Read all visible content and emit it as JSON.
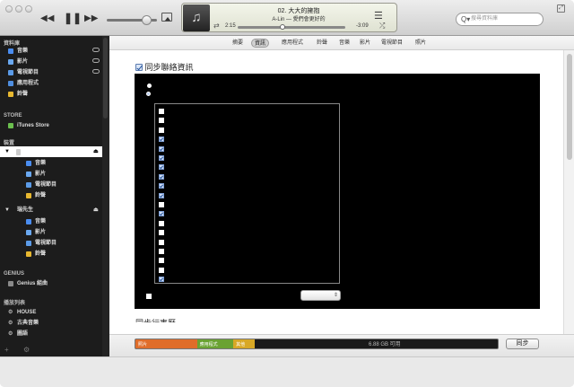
{
  "window": {
    "fullscreen_glyph": "⤢"
  },
  "player": {
    "prev_glyph": "◀◀",
    "pause_glyph": "❚❚",
    "next_glyph": "▶▶",
    "art_glyph": "♫",
    "song_title": "02. 大大的擁抱",
    "artist_album": "A-Lin — 愛們會更好的",
    "elapsed": "2:15",
    "remaining": "-3:09",
    "progress_fraction": 0.42,
    "volume_fraction": 0.78,
    "repeat_glyph": "⇄",
    "shuffle_glyph": "⤮",
    "list_glyph": "☰"
  },
  "search": {
    "placeholder": "搜尋資料庫",
    "icon": "search-icon",
    "icon_glyph": "Q▾"
  },
  "sidebar": {
    "library_header": "資料庫",
    "library_items": [
      {
        "label": "音樂",
        "icon": "music-icon",
        "color": "#4a8df0"
      },
      {
        "label": "影片",
        "icon": "movie-icon",
        "color": "#6aa8f0"
      },
      {
        "label": "電視節目",
        "icon": "tv-icon",
        "color": "#5b9be8"
      },
      {
        "label": "應用程式",
        "icon": "apps-icon",
        "color": "#4f8ee0"
      },
      {
        "label": "鈴聲",
        "icon": "bell-icon",
        "color": "#e8b830"
      }
    ],
    "store_header": "STORE",
    "store_item": "iTunes Store",
    "devices_header": "裝置",
    "device1_name": "",
    "device1_items": [
      "音樂",
      "影片",
      "電視節目",
      "鈴聲"
    ],
    "device2_name": "瑞先生",
    "device2_items": [
      "音樂",
      "影片",
      "電視節目",
      "鈴聲"
    ],
    "genius_header": "GENIUS",
    "genius_item": "Genius 組曲",
    "playlists_header": "播放列表",
    "playlist_items": [
      "HOUSE",
      "古典音樂",
      "圖語"
    ],
    "add_glyph": "+",
    "gear_glyph": "⚙"
  },
  "tabs": [
    {
      "label": "摘要",
      "active": false
    },
    {
      "label": "資訊",
      "active": true
    },
    {
      "label": "應用程式",
      "active": false
    },
    {
      "label": "鈴聲",
      "active": false
    },
    {
      "label": "音樂",
      "active": false
    },
    {
      "label": "影片",
      "active": false
    },
    {
      "label": "電視節目",
      "active": false
    },
    {
      "label": "照片",
      "active": false
    }
  ],
  "sync_contacts": {
    "label": "同步聯絡資訊",
    "checked": true
  },
  "contact_list": {
    "items_checked": [
      false,
      false,
      false,
      true,
      true,
      true,
      true,
      true,
      true,
      true,
      false,
      true,
      false,
      false,
      false,
      false,
      false,
      false,
      true
    ]
  },
  "dropdown": {
    "glyph": "⇕"
  },
  "calendar_heading": "同步行事曆",
  "capacity": {
    "segments": [
      {
        "label": "照片",
        "color": "#e06d2a",
        "fraction": 0.17
      },
      {
        "label": "應用程式",
        "color": "#6aa232",
        "fraction": 0.1
      },
      {
        "label": "其他",
        "color": "#d8a826",
        "fraction": 0.06
      }
    ],
    "free_label": "6.88 GB 可用"
  },
  "sync_button": "同步"
}
